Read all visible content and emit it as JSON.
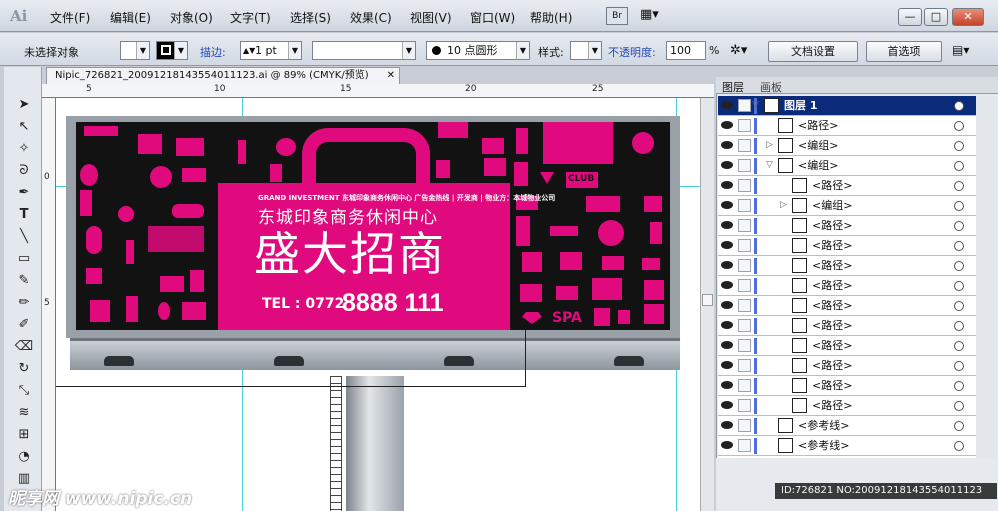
{
  "app": {
    "logo": "Ai"
  },
  "menu": {
    "items": [
      "文件(F)",
      "编辑(E)",
      "对象(O)",
      "文字(T)",
      "选择(S)",
      "效果(C)",
      "视图(V)",
      "窗口(W)",
      "帮助(H)"
    ],
    "br_button": "Br"
  },
  "window_controls": {
    "minimize": "—",
    "maximize": "□",
    "close": "✕"
  },
  "control_bar": {
    "selection_status": "未选择对象",
    "stroke_label": "描边:",
    "stroke_weight": "1 pt",
    "brush_value": "10 点圆形",
    "style_label": "样式:",
    "opacity_label": "不透明度:",
    "opacity_value": "100",
    "opacity_unit": "%",
    "doc_setup_button": "文档设置",
    "preferences_button": "首选项"
  },
  "document_tab": {
    "title": "Nipic_726821_20091218143554011123.ai @ 89% (CMYK/预览)",
    "close": "✕"
  },
  "ruler": {
    "top": [
      "5",
      "10",
      "15",
      "20",
      "25"
    ],
    "left": [
      "0",
      "5"
    ]
  },
  "billboard": {
    "small_text": "GRAND INVESTMENT 东城印象商务休闲中心 广告金热线 | 开发商 | 物业方：本城物业公司",
    "company": "东城印象商务休闲中心",
    "headline": "盛大招商",
    "tel_label": "TEL : 0772",
    "tel_number": "8888 111",
    "icon_label_club": "CLUB",
    "icon_label_spa": "SPA"
  },
  "panel": {
    "tabs": [
      "图层",
      "画板"
    ],
    "layers": [
      {
        "name": "图层 1",
        "level": 0,
        "top": true,
        "expanded": true
      },
      {
        "name": "<路径>",
        "level": 1
      },
      {
        "name": "<编组>",
        "level": 1,
        "collapsed": true
      },
      {
        "name": "<编组>",
        "level": 1,
        "expanded": true
      },
      {
        "name": "<路径>",
        "level": 2
      },
      {
        "name": "<编组>",
        "level": 2,
        "collapsed": true
      },
      {
        "name": "<路径>",
        "level": 2
      },
      {
        "name": "<路径>",
        "level": 2
      },
      {
        "name": "<路径>",
        "level": 2
      },
      {
        "name": "<路径>",
        "level": 2
      },
      {
        "name": "<路径>",
        "level": 2
      },
      {
        "name": "<路径>",
        "level": 2
      },
      {
        "name": "<路径>",
        "level": 2
      },
      {
        "name": "<路径>",
        "level": 2
      },
      {
        "name": "<路径>",
        "level": 2
      },
      {
        "name": "<路径>",
        "level": 2
      },
      {
        "name": "<参考线>",
        "level": 1
      },
      {
        "name": "<参考线>",
        "level": 1
      }
    ]
  },
  "watermark": {
    "left": "昵享网 www.nipic.cn",
    "right": "ID:726821 NO:20091218143554011123"
  }
}
